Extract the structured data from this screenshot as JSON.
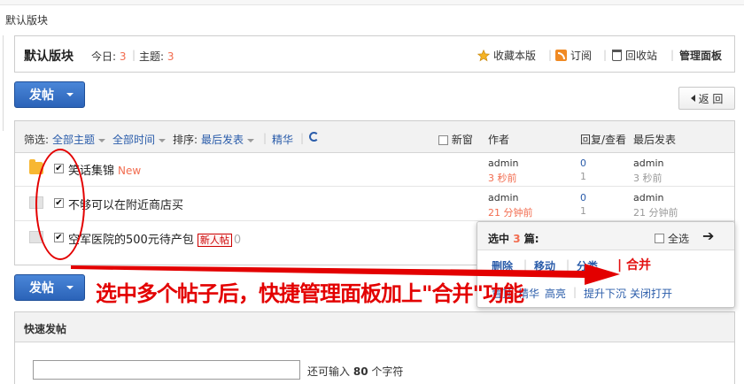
{
  "breadcrumb": "默认版块",
  "forum": {
    "title": "默认版块",
    "today_label": "今日:",
    "today_count": "3",
    "topics_label": "主题:",
    "topics_count": "3",
    "actions": {
      "favorite": "收藏本版",
      "subscribe": "订阅",
      "recycle": "回收站",
      "manage": "管理面板"
    }
  },
  "buttons": {
    "post": "发帖",
    "back": "返 回"
  },
  "filter": {
    "label": "筛选:",
    "all_topics": "全部主题",
    "all_time": "全部时间",
    "sort_label": "排序:",
    "sort_value": "最后发表",
    "digest": "精华",
    "new_window": "新窗"
  },
  "columns": {
    "author": "作者",
    "replies_views": "回复/查看",
    "last_post": "最后发表"
  },
  "threads": [
    {
      "title": "笑话集锦",
      "tag": "New",
      "author": "admin",
      "time": "3 秒前",
      "replies": "0",
      "views": "1",
      "last_author": "admin",
      "last_time": "3 秒前"
    },
    {
      "title": "不够可以在附近商店买",
      "tag": "",
      "author": "admin",
      "time": "21 分钟前",
      "replies": "0",
      "views": "1",
      "last_author": "admin",
      "last_time": "21 分钟前"
    },
    {
      "title": "空军医院的500元待产包",
      "badge": "新人帖",
      "attach": "0"
    }
  ],
  "moderation": {
    "selected_prefix": "选中",
    "selected_count": "3",
    "selected_suffix": "篇:",
    "select_all": "全选",
    "delete": "删除",
    "move": "移动",
    "classify": "分类",
    "merge": "合并",
    "sticky": "置顶",
    "digest": "精华",
    "highlight": "高亮",
    "bump": "提升下沉",
    "close": "关闭打开"
  },
  "quick_post": {
    "title": "快速发帖",
    "hint_prefix": "还可输入",
    "hint_count": "80",
    "hint_suffix": "个字符"
  },
  "annotation": {
    "text": "选中多个帖子后，快捷管理面板加上\"合并\"功能",
    "color": "#e30000"
  },
  "colors": {
    "accent_blue": "#2b63b8",
    "link_blue": "#2a5caa",
    "highlight_orange": "#f26c4f"
  }
}
